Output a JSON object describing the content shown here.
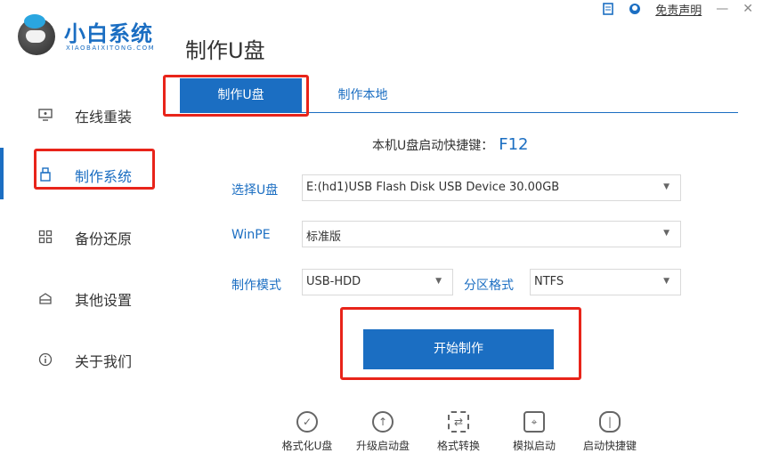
{
  "app": {
    "brand": "小白系统",
    "brand_sub": "XIAOBAIXITONG.COM",
    "page_title": "制作U盘",
    "disclaimer": "免责声明",
    "minimize": "—",
    "close": "✕"
  },
  "sidebar": {
    "items": [
      {
        "label": "在线重装",
        "icon": "monitor-icon"
      },
      {
        "label": "制作系统",
        "icon": "usb-icon"
      },
      {
        "label": "备份还原",
        "icon": "grid-icon"
      },
      {
        "label": "其他设置",
        "icon": "box-icon"
      },
      {
        "label": "关于我们",
        "icon": "info-icon"
      }
    ],
    "active_index": 1
  },
  "tabs": [
    {
      "label": "制作U盘"
    },
    {
      "label": "制作本地"
    }
  ],
  "form": {
    "hotkey_label": "本机U盘启动快捷键：",
    "hotkey_value": "F12",
    "usb_label": "选择U盘",
    "usb_value": "E:(hd1)USB Flash Disk USB Device 30.00GB",
    "winpe_label": "WinPE",
    "winpe_value": "标准版",
    "mode_label": "制作模式",
    "mode_value": "USB-HDD",
    "partition_label": "分区格式",
    "partition_value": "NTFS",
    "start_button": "开始制作"
  },
  "tools": [
    {
      "label": "格式化U盘",
      "icon": "check-circle-icon"
    },
    {
      "label": "升级启动盘",
      "icon": "arrow-up-circle-icon"
    },
    {
      "label": "格式转换",
      "icon": "convert-icon"
    },
    {
      "label": "模拟启动",
      "icon": "joystick-icon"
    },
    {
      "label": "启动快捷键",
      "icon": "mouse-icon"
    }
  ],
  "colors": {
    "accent": "#1b6ec2",
    "highlight": "#e8241a"
  }
}
